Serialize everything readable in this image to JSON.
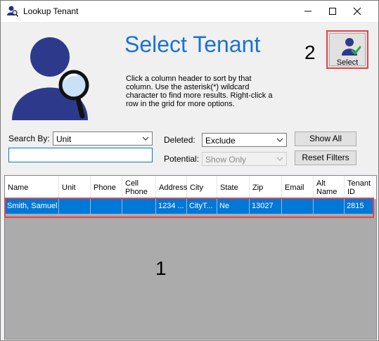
{
  "window": {
    "title": "Lookup Tenant",
    "controls": [
      "minimize",
      "maximize",
      "close"
    ]
  },
  "header": {
    "heading": "Select Tenant",
    "instructions": "Click a column header to sort by that column. Use the asterisk(*) wildcard character to find more results. Right-click a row in the grid for more options.",
    "annotation_2": "2",
    "select_button_label": "Select",
    "icons": [
      "user-search-icon",
      "user-check-icon"
    ]
  },
  "filters": {
    "search_by_label": "Search By:",
    "search_by_value": "Unit",
    "search_text": "",
    "deleted_label": "Deleted:",
    "deleted_value": "Exclude",
    "potential_label": "Potential:",
    "potential_value": "Show Only",
    "show_all_label": "Show All",
    "reset_filters_label": "Reset Filters"
  },
  "grid": {
    "columns": [
      "Name",
      "Unit",
      "Phone",
      "Cell Phone",
      "Address",
      "City",
      "State",
      "Zip",
      "Email",
      "Alt Name",
      "Tenant ID"
    ],
    "rows": [
      [
        "Smith, Samuel",
        "",
        "",
        "",
        "1234 ...",
        "CityT...",
        "Ne",
        "13027",
        "",
        "",
        "2815"
      ]
    ],
    "selected_row_color": "#0078d7"
  },
  "annotation_1": "1",
  "colors": {
    "heading": "#1a73d1",
    "annotation_border": "#e0474c",
    "selection": "#0078d7",
    "grid_background": "#ababab"
  }
}
